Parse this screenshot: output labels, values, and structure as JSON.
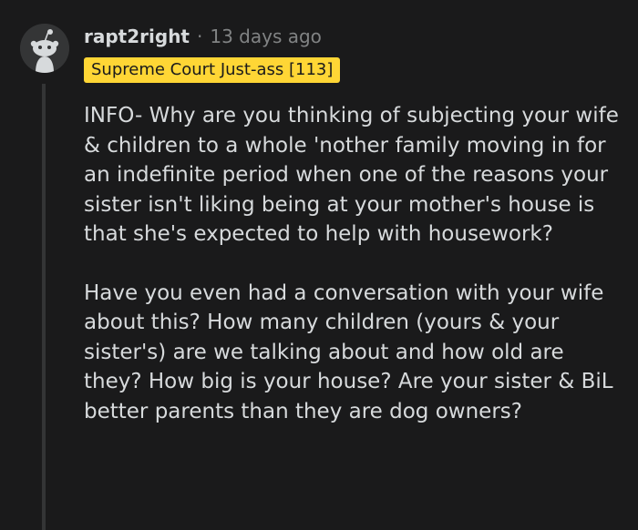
{
  "comment": {
    "username": "rapt2right",
    "separator": "·",
    "timestamp": "13 days ago",
    "flair": "Supreme Court Just-ass [113]",
    "avatar_icon": "reddit-snoo-avatar-icon",
    "paragraphs": [
      "INFO- Why are you thinking of subjecting your wife & children to a whole 'nother family moving in for an indefinite period when one of the reasons your sister isn't liking being at your mother's house is that she's expected to help with housework?",
      "Have you even had a conversation with your wife about this? How many children (yours & your sister's) are we talking about and how old are they? How big is your house? Are your sister & BiL better parents than they are dog owners?"
    ]
  },
  "colors": {
    "background": "#1a1a1b",
    "text": "#d7dadc",
    "meta_text": "#818384",
    "flair_background": "#ffd635",
    "flair_text": "#1a1a1b",
    "thread_line": "#343536"
  }
}
